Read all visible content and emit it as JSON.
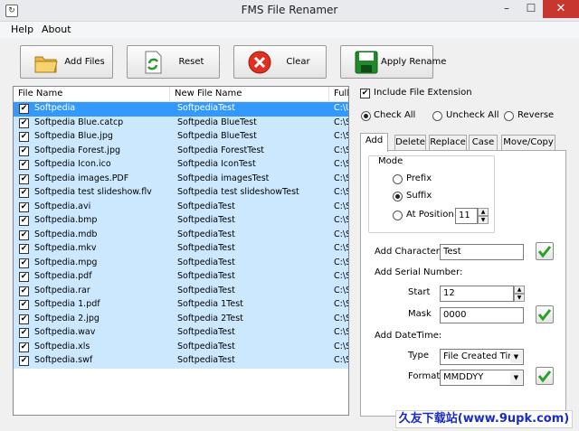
{
  "window": {
    "title": "FMS File Renamer",
    "min": "–",
    "max": "☐",
    "close": "✕"
  },
  "menu": [
    "Help",
    "About"
  ],
  "toolbar": {
    "add_files": "Add Files",
    "reset": "Reset",
    "clear": "Clear",
    "apply_rename": "Apply Rename"
  },
  "list": {
    "columns": [
      "File Name",
      "New File Name",
      "Full P"
    ],
    "rows": [
      {
        "name": "Softpedia",
        "new": "SoftpediaTest",
        "path": "C:\\U"
      },
      {
        "name": "Softpedia Blue.catcp",
        "new": "Softpedia BlueTest",
        "path": "C:\\S"
      },
      {
        "name": "Softpedia Blue.jpg",
        "new": "Softpedia BlueTest",
        "path": "C:\\S"
      },
      {
        "name": "Softpedia Forest.jpg",
        "new": "Softpedia ForestTest",
        "path": "C:\\S"
      },
      {
        "name": "Softpedia Icon.ico",
        "new": "Softpedia IconTest",
        "path": "C:\\S"
      },
      {
        "name": "Softpedia images.PDF",
        "new": "Softpedia imagesTest",
        "path": "C:\\S"
      },
      {
        "name": "Softpedia test slideshow.flv",
        "new": "Softpedia test slideshowTest",
        "path": "C:\\S"
      },
      {
        "name": "Softpedia.avi",
        "new": "SoftpediaTest",
        "path": "C:\\S"
      },
      {
        "name": "Softpedia.bmp",
        "new": "SoftpediaTest",
        "path": "C:\\S"
      },
      {
        "name": "Softpedia.mdb",
        "new": "SoftpediaTest",
        "path": "C:\\S"
      },
      {
        "name": "Softpedia.mkv",
        "new": "SoftpediaTest",
        "path": "C:\\S"
      },
      {
        "name": "Softpedia.mpg",
        "new": "SoftpediaTest",
        "path": "C:\\S"
      },
      {
        "name": "Softpedia.pdf",
        "new": "SoftpediaTest",
        "path": "C:\\S"
      },
      {
        "name": "Softpedia.rar",
        "new": "SoftpediaTest",
        "path": "C:\\S"
      },
      {
        "name": "Softpedia 1.pdf",
        "new": "Softpedia 1Test",
        "path": "C:\\S"
      },
      {
        "name": "Softpedia 2.jpg",
        "new": "Softpedia 2Test",
        "path": "C:\\S"
      },
      {
        "name": "Softpedia.wav",
        "new": "SoftpediaTest",
        "path": "C:\\S"
      },
      {
        "name": "Softpedia.xls",
        "new": "SoftpediaTest",
        "path": "C:\\S"
      },
      {
        "name": "Softpedia.swf",
        "new": "SoftpediaTest",
        "path": "C:\\S"
      }
    ]
  },
  "options": {
    "include_ext": "Include File Extension",
    "check_all": "Check All",
    "uncheck_all": "Uncheck All",
    "reverse": "Reverse"
  },
  "tabs": [
    "Add",
    "Delete",
    "Replace",
    "Case",
    "Move/Copy"
  ],
  "add_tab": {
    "mode_label": "Mode",
    "prefix": "Prefix",
    "suffix": "Suffix",
    "at_position": "At Position",
    "position_value": "11",
    "add_characters_label": "Add Characters:",
    "add_characters_value": "Test",
    "serial_label": "Add Serial Number:",
    "start_label": "Start",
    "start_value": "12",
    "mask_label": "Mask",
    "mask_value": "0000",
    "datetime_label": "Add DateTime:",
    "type_label": "Type",
    "type_value": "File Created Time",
    "format_label": "Format",
    "format_value": "MMDDYY"
  },
  "watermark": "久友下载站(www.9upk.com)",
  "colors": {
    "selection": "#3399ff",
    "row_bg": "#cce8ff",
    "close": "#c7372f"
  }
}
